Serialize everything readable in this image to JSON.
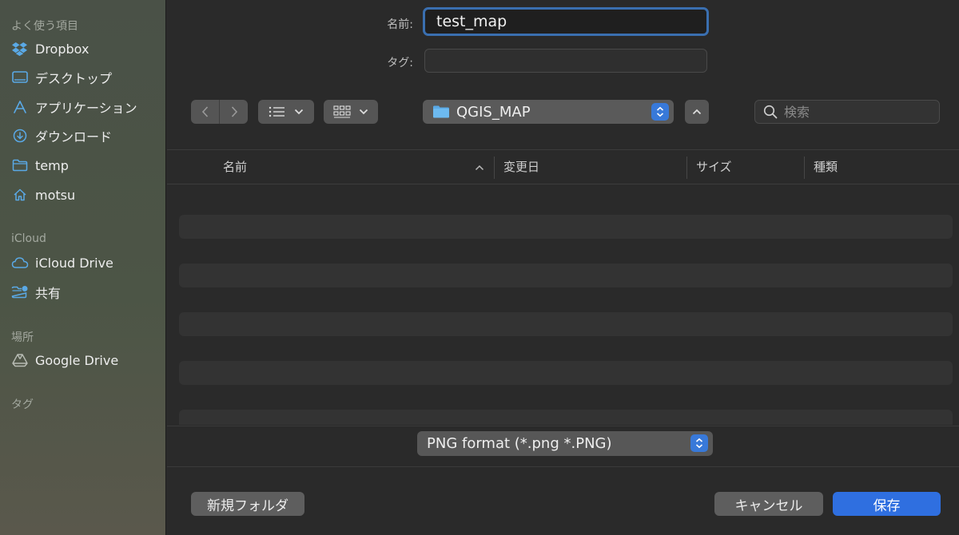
{
  "sidebar": {
    "sections": {
      "favorites": "よく使う項目",
      "icloud": "iCloud",
      "locations": "場所",
      "tags": "タグ"
    },
    "favorites": [
      {
        "label": "Dropbox",
        "icon": "dropbox-icon"
      },
      {
        "label": "デスクトップ",
        "icon": "desktop-icon"
      },
      {
        "label": "アプリケーション",
        "icon": "applications-icon"
      },
      {
        "label": "ダウンロード",
        "icon": "download-icon"
      },
      {
        "label": "temp",
        "icon": "folder-icon"
      },
      {
        "label": "motsu",
        "icon": "home-icon"
      }
    ],
    "icloud_items": [
      {
        "label": "iCloud Drive",
        "icon": "cloud-icon"
      },
      {
        "label": "共有",
        "icon": "shared-folder-icon"
      }
    ],
    "location_items": [
      {
        "label": "Google Drive",
        "icon": "drive-icon"
      }
    ]
  },
  "save_form": {
    "name_label": "名前:",
    "name_value": "test_map",
    "tag_label": "タグ:",
    "tag_value": ""
  },
  "toolbar": {
    "current_folder": "QGIS_MAP",
    "search_placeholder": "検索"
  },
  "table": {
    "columns": [
      "名前",
      "変更日",
      "サイズ",
      "種類"
    ],
    "sort_column": "名前",
    "sort_direction": "ascending"
  },
  "format": {
    "selected": "PNG format (*.png *.PNG)"
  },
  "buttons": {
    "new_folder": "新規フォルダ",
    "cancel": "キャンセル",
    "save": "保存"
  },
  "colors": {
    "accent": "#2f6fe0",
    "focus_ring": "#3a6fb0",
    "folder": "#5aa9e6"
  }
}
